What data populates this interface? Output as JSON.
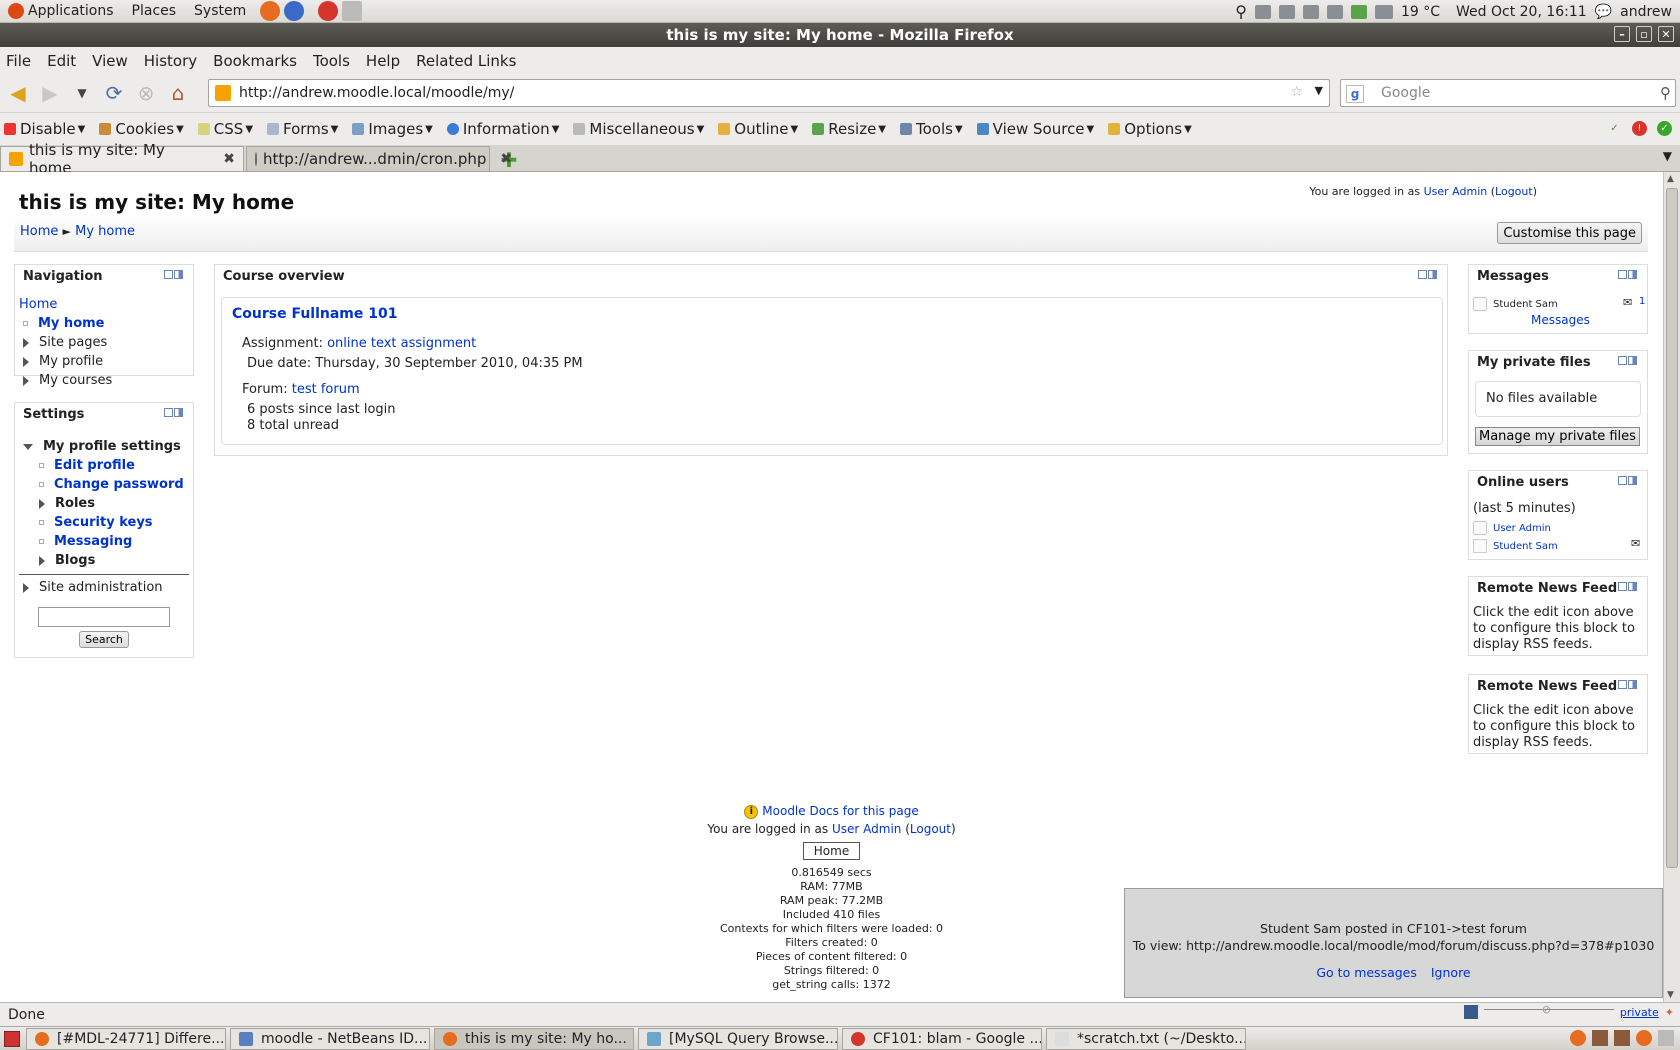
{
  "gnome_panel": {
    "menus": [
      "Applications",
      "Places",
      "System"
    ],
    "weather": "19 °C",
    "clock": "Wed Oct 20, 16:11",
    "user": "andrew"
  },
  "window": {
    "title": "this is my site: My home - Mozilla Firefox"
  },
  "menubar": [
    "File",
    "Edit",
    "View",
    "History",
    "Bookmarks",
    "Tools",
    "Help",
    "Related Links"
  ],
  "navbar": {
    "url": "http://andrew.moodle.local/moodle/my/",
    "search_placeholder": "Google"
  },
  "devbar": [
    "Disable",
    "Cookies",
    "CSS",
    "Forms",
    "Images",
    "Information",
    "Miscellaneous",
    "Outline",
    "Resize",
    "Tools",
    "View Source",
    "Options"
  ],
  "tabs": [
    {
      "label": "this is my site: My home"
    },
    {
      "label": "http://andrew...dmin/cron.php"
    }
  ],
  "page": {
    "site_title": "this is my site: My home",
    "login_prefix": "You are logged in as",
    "login_user": "User Admin",
    "logout": "Logout",
    "breadcrumb": {
      "home": "Home",
      "sep": "►",
      "current": "My home"
    },
    "customise_button": "Customise this page"
  },
  "navigation": {
    "title": "Navigation",
    "home": "Home",
    "items": [
      "My home",
      "Site pages",
      "My profile",
      "My courses"
    ]
  },
  "settings": {
    "title": "Settings",
    "profile_settings": "My profile settings",
    "items": [
      "Edit profile",
      "Change password",
      "Roles",
      "Security keys",
      "Messaging",
      "Blogs"
    ],
    "site_admin": "Site administration",
    "search_button": "Search"
  },
  "course_overview": {
    "title": "Course overview",
    "course_name": "Course Fullname 101",
    "assignment_label": "Assignment:",
    "assignment_name": "online text assignment",
    "due_date": "Due date: Thursday, 30 September 2010, 04:35 PM",
    "forum_label": "Forum:",
    "forum_name": "test forum",
    "posts_since": "6 posts since last login",
    "total_unread": "8 total unread"
  },
  "messages_block": {
    "title": "Messages",
    "user": "Student Sam",
    "count": "1",
    "link": "Messages"
  },
  "files_block": {
    "title": "My private files",
    "empty": "No files available",
    "manage_button": "Manage my private files"
  },
  "online_block": {
    "title": "Online users",
    "period": "(last 5 minutes)",
    "users": [
      "User Admin",
      "Student Sam"
    ]
  },
  "rss_blocks": [
    {
      "title": "Remote News Feed",
      "body": "Click the edit icon above to configure this block to display RSS feeds."
    },
    {
      "title": "Remote News Feed",
      "body": "Click the edit icon above to configure this block to display RSS feeds."
    }
  ],
  "footer": {
    "docs_link": "Moodle Docs for this page",
    "login_prefix": "You are logged in as",
    "login_user": "User Admin",
    "logout": "Logout",
    "home_button": "Home",
    "perf": [
      "0.816549 secs",
      "RAM: 77MB",
      "RAM peak: 77.2MB",
      "Included 410 files",
      "Contexts for which filters were loaded: 0",
      "Filters created: 0",
      "Pieces of content filtered: 0",
      "Strings filtered: 0",
      "get_string calls: 1372"
    ]
  },
  "notification": {
    "line1": "Student Sam posted in CF101->test forum",
    "line2": "To view: http://andrew.moodle.local/moodle/mod/forum/discuss.php?d=378#p1030",
    "goto": "Go to messages",
    "ignore": "Ignore"
  },
  "statusbar": {
    "text": "Done",
    "private": "private"
  },
  "taskbar": [
    "[#MDL-24771] Differe...",
    "moodle - NetBeans ID...",
    "this is my site: My ho...",
    "[MySQL Query Browse...",
    "CF101: blam - Google ...",
    "*scratch.txt (~/Deskto..."
  ]
}
